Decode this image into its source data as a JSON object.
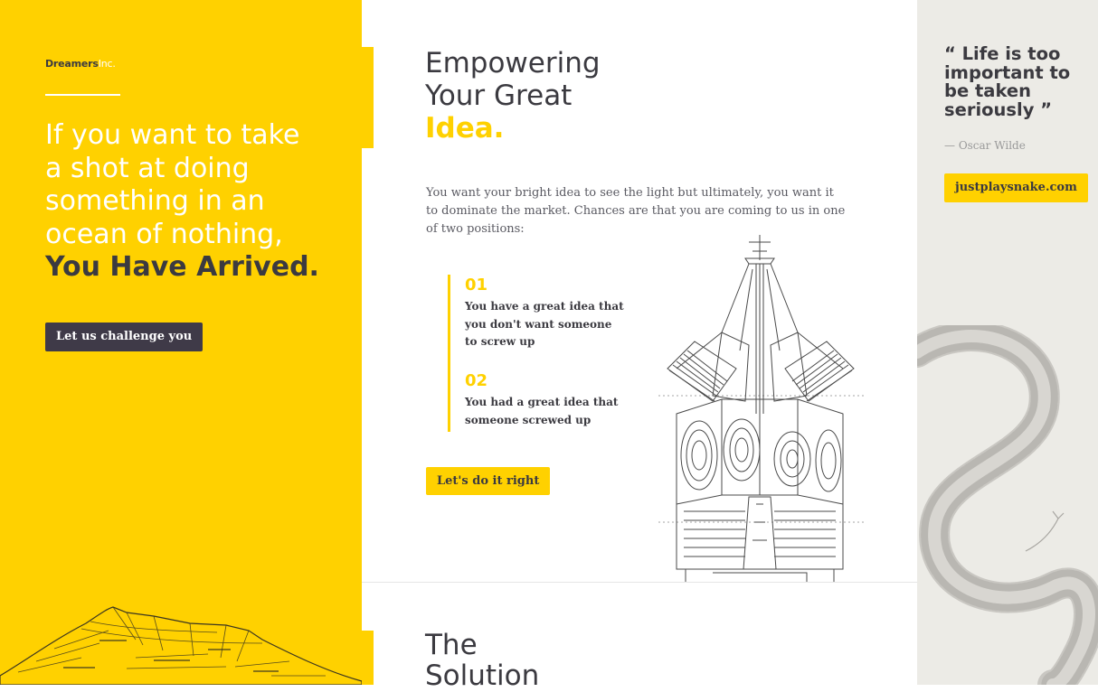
{
  "brand": {
    "name": "Dreamers",
    "suffix": "Inc."
  },
  "hero": {
    "lines": [
      "If you want to take",
      "a shot at doing",
      "something in an",
      "ocean of nothing,"
    ],
    "strong": "You Have Arrived."
  },
  "buttons": {
    "challenge": "Let us challenge you",
    "do_it_right": "Let's do it right",
    "link": "justplaysnake.com"
  },
  "main": {
    "title_lines": [
      "Empowering",
      "Your Great"
    ],
    "title_accent": "Idea.",
    "intro": "You want your bright idea to see the light but ultimately, you want it to dominate the market. Chances are that you are coming to us in one of two positions:",
    "items": [
      {
        "num": "01",
        "lines": [
          "You have a great idea that",
          "you don't want someone",
          "to screw up"
        ]
      },
      {
        "num": "02",
        "lines": [
          "You had a great idea that",
          "someone screwed up"
        ]
      }
    ],
    "solution_lines": [
      "The",
      "Solution"
    ]
  },
  "quote": {
    "text_lines": [
      "“ Life is too",
      "important to",
      "be taken",
      "seriously ”"
    ],
    "author": "— Oscar Wilde"
  },
  "colors": {
    "accent": "#FFD100",
    "dark": "#3b3a40",
    "panel": "#ecebe6"
  },
  "illustrations": [
    "mountain-illustration",
    "lighthouse-lens-illustration",
    "snake-illustration"
  ]
}
